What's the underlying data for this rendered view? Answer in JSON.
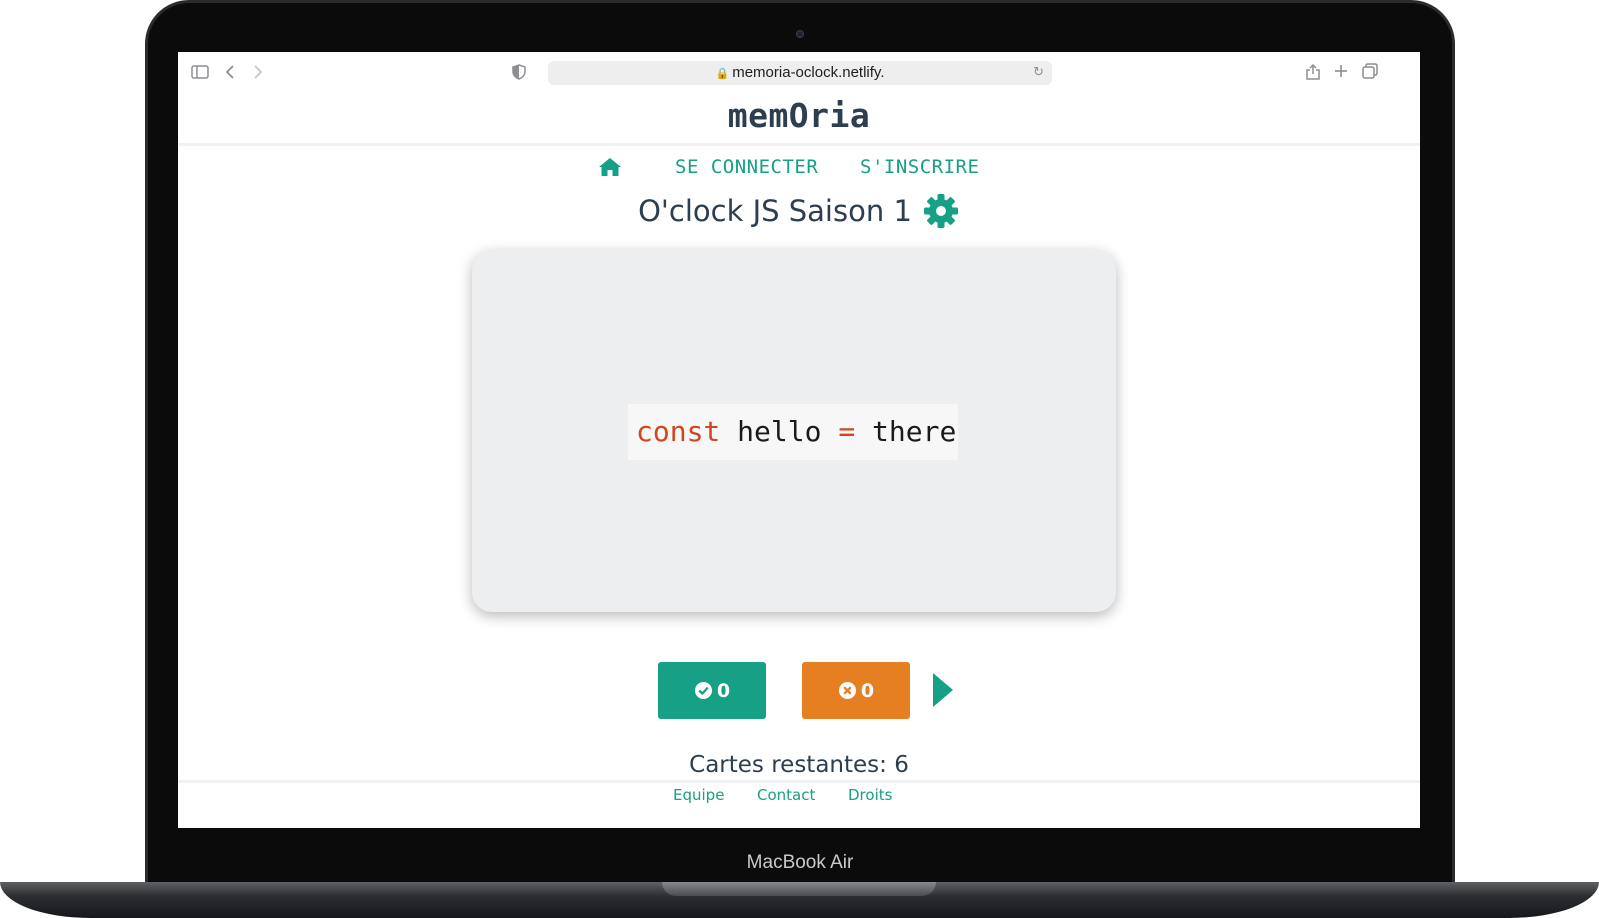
{
  "device": {
    "label": "MacBook Air"
  },
  "browser": {
    "url": "memoria-oclock.netlify.",
    "icons": [
      "sidebar-icon",
      "back-icon",
      "forward-icon",
      "shield-icon",
      "lock-icon",
      "reload-icon",
      "share-icon",
      "new-tab-icon",
      "tabs-icon"
    ]
  },
  "app": {
    "title": "memOria",
    "nav": {
      "home_icon": "home-icon",
      "login_label": "SE CONNECTER",
      "signup_label": "S'INSCRIRE"
    },
    "deck": {
      "title": "O'clock JS Saison 1",
      "settings_icon": "gear-icon"
    },
    "card": {
      "code_keyword": "const",
      "code_identifier": "hello",
      "code_operator": "=",
      "code_value": "there"
    },
    "score": {
      "correct_count": "0",
      "wrong_count": "0",
      "correct_icon": "check-circle-icon",
      "wrong_icon": "times-circle-icon",
      "next_icon": "play-icon"
    },
    "remaining_label": "Cartes restantes: 6",
    "footer": {
      "team_label": "Equipe",
      "contact_label": "Contact",
      "rights_label": "Droits"
    }
  },
  "colors": {
    "accent": "#16a085",
    "warning": "#e67e22",
    "text": "#2c3e50",
    "card_bg": "#eceeef",
    "code_keyword": "#d2461e"
  }
}
